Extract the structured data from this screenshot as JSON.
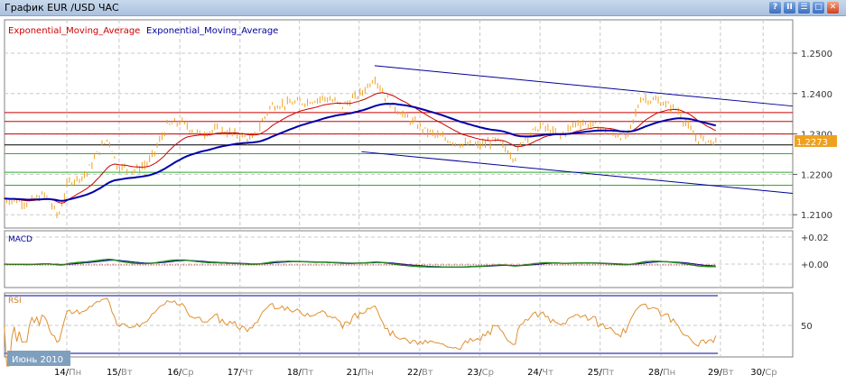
{
  "window": {
    "title": "График EUR /USD  ЧАС",
    "buttons": [
      "?",
      "II",
      "☰",
      "□",
      "✕"
    ]
  },
  "legend": [
    {
      "label": "Exponential_Moving_Average",
      "color": "#cc0000"
    },
    {
      "label": "Exponential_Moving_Average",
      "color": "#000099"
    }
  ],
  "month_label": "Июнь 2010",
  "chart_data": [
    {
      "type": "line",
      "title": "EUR/USD H1",
      "ylim": [
        1.2065,
        1.254
      ],
      "y_ticks": [
        "1.2500",
        "1.2400",
        "1.2300",
        "1.2200",
        "1.2100"
      ],
      "y_tick_values": [
        1.25,
        1.24,
        1.23,
        1.22,
        1.21
      ],
      "current_price": "1.2273",
      "current_price_value": 1.2273,
      "x_ticks": [
        {
          "label": "14/",
          "day": "Пн",
          "t": 0
        },
        {
          "label": "15/",
          "day": "Вт",
          "t": 0.87
        },
        {
          "label": "16/",
          "day": "Ср",
          "t": 1.88
        },
        {
          "label": "17/",
          "day": "Чт",
          "t": 2.88
        },
        {
          "label": "18/",
          "day": "Пт",
          "t": 3.87
        },
        {
          "label": "21/",
          "day": "Пн",
          "t": 4.86
        },
        {
          "label": "22/",
          "day": "Вт",
          "t": 5.87
        },
        {
          "label": "23/",
          "day": "Ср",
          "t": 6.87
        },
        {
          "label": "24/",
          "day": "Чт",
          "t": 7.87
        },
        {
          "label": "25/",
          "day": "Пт",
          "t": 8.87
        },
        {
          "label": "28/",
          "day": "Пн",
          "t": 9.88
        },
        {
          "label": "29/",
          "day": "Вт",
          "t": 10.87
        },
        {
          "label": "30/",
          "day": "Ср",
          "t": 11.58
        }
      ],
      "xlim": [
        -1.04,
        12.07
      ],
      "price_points": [
        [
          -1.04,
          1.214
        ],
        [
          -0.66,
          1.213
        ],
        [
          -0.36,
          1.215
        ],
        [
          -0.14,
          1.2095
        ],
        [
          0.02,
          1.218
        ],
        [
          0.32,
          1.22
        ],
        [
          0.54,
          1.226
        ],
        [
          0.69,
          1.229
        ],
        [
          0.84,
          1.222
        ],
        [
          1.14,
          1.221
        ],
        [
          1.37,
          1.223
        ],
        [
          1.67,
          1.232
        ],
        [
          1.89,
          1.233
        ],
        [
          2.19,
          1.23
        ],
        [
          2.49,
          1.231
        ],
        [
          2.79,
          1.23
        ],
        [
          3.09,
          1.2285
        ],
        [
          3.39,
          1.237
        ],
        [
          3.69,
          1.2375
        ],
        [
          3.99,
          1.238
        ],
        [
          4.29,
          1.239
        ],
        [
          4.59,
          1.237
        ],
        [
          4.89,
          1.24
        ],
        [
          5.12,
          1.244
        ],
        [
          5.35,
          1.238
        ],
        [
          5.65,
          1.234
        ],
        [
          5.95,
          1.231
        ],
        [
          6.25,
          1.229
        ],
        [
          6.55,
          1.2275
        ],
        [
          6.85,
          1.227
        ],
        [
          7.15,
          1.2285
        ],
        [
          7.45,
          1.224
        ],
        [
          7.6,
          1.229
        ],
        [
          7.9,
          1.232
        ],
        [
          8.2,
          1.2295
        ],
        [
          8.5,
          1.233
        ],
        [
          8.8,
          1.232
        ],
        [
          9.1,
          1.23
        ],
        [
          9.32,
          1.229
        ],
        [
          9.55,
          1.239
        ],
        [
          9.85,
          1.238
        ],
        [
          10.15,
          1.236
        ],
        [
          10.45,
          1.229
        ],
        [
          10.83,
          1.2278
        ]
      ],
      "horizontal_lines": [
        {
          "price": 1.2353,
          "color": "#cc0000"
        },
        {
          "price": 1.2331,
          "color": "#cc0000"
        },
        {
          "price": 1.23,
          "color": "#cc0000"
        },
        {
          "price": 1.2273,
          "color": "#000000"
        },
        {
          "price": 1.2251,
          "color": "#33aa33"
        },
        {
          "price": 1.2205,
          "color": "#33aa33"
        },
        {
          "price": 1.2173,
          "color": "#33aa33"
        }
      ],
      "trend_lines": [
        {
          "from": [
            5.12,
            1.2469
          ],
          "to": [
            12.07,
            1.2369
          ],
          "color": "#000099"
        },
        {
          "from": [
            4.9,
            1.2256
          ],
          "to": [
            12.07,
            1.2153
          ],
          "color": "#000099"
        }
      ],
      "colors": {
        "price": "#f0a020",
        "ema_fast": "#cc0000",
        "ema_slow": "#0000aa"
      }
    },
    {
      "type": "line",
      "title": "MACD",
      "y_ticks": [
        "+0.02",
        "+0.00"
      ],
      "y_tick_values": [
        0.02,
        0
      ]
    },
    {
      "type": "line",
      "title": "RSI",
      "y_ticks": [
        "50"
      ],
      "y_tick_values": [
        50
      ]
    }
  ]
}
